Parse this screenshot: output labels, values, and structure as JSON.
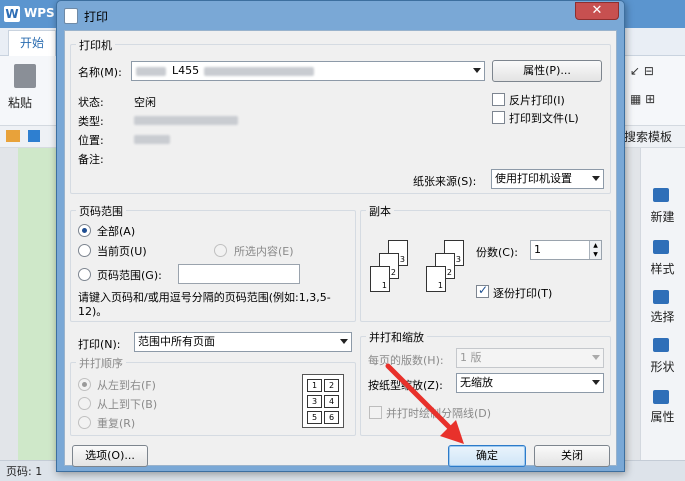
{
  "app": {
    "name": "WPS",
    "tab_start": "开始",
    "paste_label": "粘贴",
    "template_search": "搜索模板",
    "right_panel": [
      "新建",
      "样式",
      "选择",
      "形状",
      "属性"
    ],
    "status_page": "页码: 1",
    "toolbar_glyphs_1": "↙ ⊟",
    "toolbar_glyphs_2": "▦ ⊞"
  },
  "dialog": {
    "title": "打印",
    "close_glyph": "✕",
    "printer_group": {
      "title": "打印机",
      "name_label": "名称(M):",
      "name_value": "L455",
      "properties_button": "属性(P)...",
      "status_label": "状态:",
      "status_value": "空闲",
      "type_label": "类型:",
      "location_label": "位置:",
      "comment_label": "备注:",
      "reverse_print": "反片打印(I)",
      "print_to_file": "打印到文件(L)",
      "paper_source_label": "纸张来源(S):",
      "paper_source_value": "使用打印机设置"
    },
    "page_range": {
      "title": "页码范围",
      "all": "全部(A)",
      "current": "当前页(U)",
      "selection": "所选内容(E)",
      "pages": "页码范围(G):",
      "hint": "请键入页码和/或用逗号分隔的页码范围(例如:1,3,5-12)。"
    },
    "copies": {
      "title": "副本",
      "count_label": "份数(C):",
      "count_value": "1",
      "collate": "逐份打印(T)"
    },
    "print_what": {
      "label": "打印(N):",
      "value": "范围中所有页面"
    },
    "order": {
      "title": "并打顺序",
      "left_to_right": "从左到右(F)",
      "top_to_bottom": "从上到下(B)",
      "repeat": "重复(R)"
    },
    "zoom": {
      "title": "并打和缩放",
      "pages_per_sheet_label": "每页的版数(H):",
      "pages_per_sheet_value": "1 版",
      "scale_label": "按纸型缩放(Z):",
      "scale_value": "无缩放",
      "draw_borders": "并打时绘制分隔线(D)"
    },
    "buttons": {
      "options": "选项(O)...",
      "ok": "确定",
      "close": "关闭"
    }
  },
  "annotation": {
    "arrow_color": "#e8312b"
  }
}
